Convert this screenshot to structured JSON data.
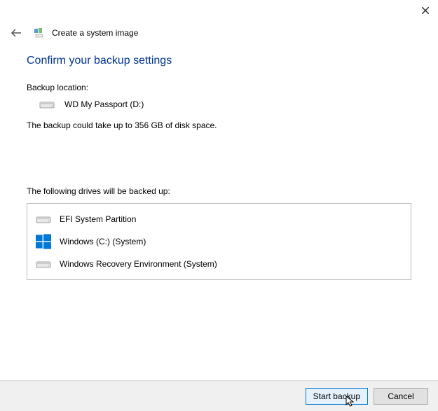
{
  "header": {
    "title": "Create a system image"
  },
  "page": {
    "heading": "Confirm your backup settings",
    "backup_location_label": "Backup location:",
    "backup_location_value": "WD My Passport (D:)",
    "size_text": "The backup could take up to 356 GB of disk space.",
    "drives_label": "The following drives will be backed up:",
    "drives": [
      {
        "name": "EFI System Partition",
        "icon": "hdd"
      },
      {
        "name": "Windows (C:) (System)",
        "icon": "windows"
      },
      {
        "name": "Windows Recovery Environment (System)",
        "icon": "hdd"
      }
    ]
  },
  "buttons": {
    "start_backup": "Start backup",
    "cancel": "Cancel"
  }
}
